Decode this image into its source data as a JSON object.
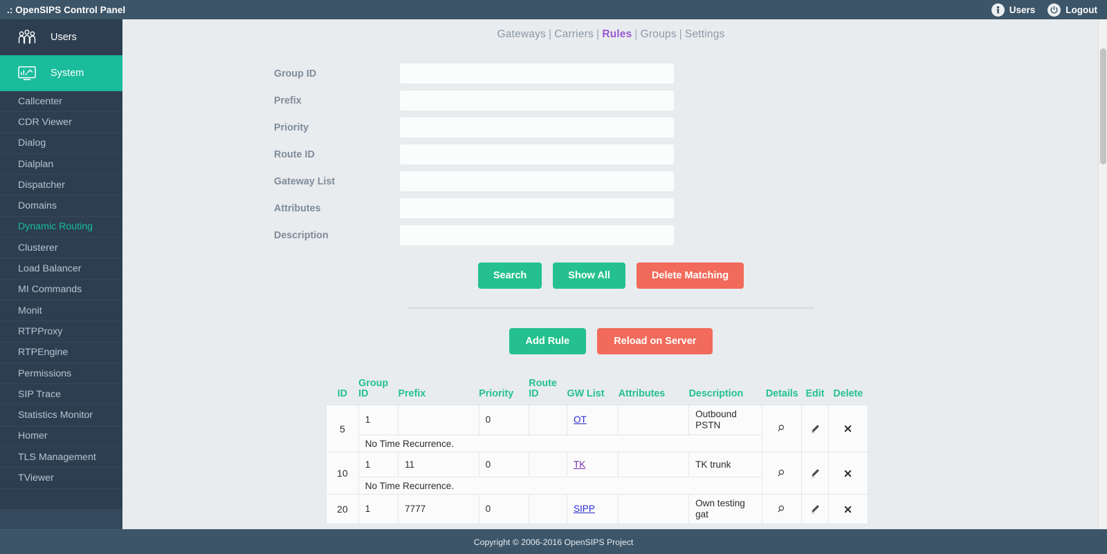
{
  "header": {
    "title": ".: OpenSIPS Control Panel",
    "users_label": "Users",
    "logout_label": "Logout"
  },
  "sidebar": {
    "main": [
      {
        "label": "Users",
        "icon": "users-group-icon",
        "active": false
      },
      {
        "label": "System",
        "icon": "system-monitor-icon",
        "active": true
      }
    ],
    "items": [
      {
        "label": "Callcenter",
        "active": false
      },
      {
        "label": "CDR Viewer",
        "active": false
      },
      {
        "label": "Dialog",
        "active": false
      },
      {
        "label": "Dialplan",
        "active": false
      },
      {
        "label": "Dispatcher",
        "active": false
      },
      {
        "label": "Domains",
        "active": false
      },
      {
        "label": "Dynamic Routing",
        "active": true
      },
      {
        "label": "Clusterer",
        "active": false
      },
      {
        "label": "Load Balancer",
        "active": false
      },
      {
        "label": "MI Commands",
        "active": false
      },
      {
        "label": "Monit",
        "active": false
      },
      {
        "label": "RTPProxy",
        "active": false
      },
      {
        "label": "RTPEngine",
        "active": false
      },
      {
        "label": "Permissions",
        "active": false
      },
      {
        "label": "SIP Trace",
        "active": false
      },
      {
        "label": "Statistics Monitor",
        "active": false
      },
      {
        "label": "Homer",
        "active": false
      },
      {
        "label": "TLS Management",
        "active": false
      },
      {
        "label": "TViewer",
        "active": false
      }
    ]
  },
  "tabs": [
    {
      "label": "Gateways",
      "active": false
    },
    {
      "label": "Carriers",
      "active": false
    },
    {
      "label": "Rules",
      "active": true
    },
    {
      "label": "Groups",
      "active": false
    },
    {
      "label": "Settings",
      "active": false
    }
  ],
  "tab_separator": "|",
  "form": {
    "fields": [
      {
        "label": "Group ID",
        "value": "",
        "placeholder": ""
      },
      {
        "label": "Prefix",
        "value": "",
        "placeholder": ""
      },
      {
        "label": "Priority",
        "value": "",
        "placeholder": ""
      },
      {
        "label": "Route ID",
        "value": "",
        "placeholder": ""
      },
      {
        "label": "Gateway List",
        "value": "",
        "placeholder": ""
      },
      {
        "label": "Attributes",
        "value": "",
        "placeholder": ""
      },
      {
        "label": "Description",
        "value": "",
        "placeholder": ""
      }
    ]
  },
  "actions": {
    "search": "Search",
    "show_all": "Show All",
    "delete_matching": "Delete Matching",
    "add_rule": "Add Rule",
    "reload_on_server": "Reload on Server"
  },
  "table": {
    "headers": [
      "ID",
      "Group ID",
      "Prefix",
      "Priority",
      "Route ID",
      "GW List",
      "Attributes",
      "Description",
      "Details",
      "Edit",
      "Delete"
    ],
    "rows": [
      {
        "id": "5",
        "group_id": "1",
        "prefix": "",
        "priority": "0",
        "route_id": "",
        "gw_list": "OT",
        "gw_visited": false,
        "attributes": "",
        "description": "Outbound PSTN",
        "time_recurrence": "No Time Recurrence."
      },
      {
        "id": "10",
        "group_id": "1",
        "prefix": "11",
        "priority": "0",
        "route_id": "",
        "gw_list": "TK",
        "gw_visited": true,
        "attributes": "",
        "description": "TK trunk",
        "time_recurrence": "No Time Recurrence."
      },
      {
        "id": "20",
        "group_id": "1",
        "prefix": "7777",
        "priority": "0",
        "route_id": "",
        "gw_list": "SIPP",
        "gw_visited": false,
        "attributes": "",
        "description": "Own testing gat",
        "time_recurrence": ""
      }
    ],
    "icons": {
      "details": "magnifier-icon",
      "edit": "pencil-icon",
      "delete": "cross-icon"
    }
  },
  "footer": {
    "copyright": "Copyright © 2006-2016 OpenSIPS Project"
  },
  "colors": {
    "accent_green": "#24c18e",
    "accent_red": "#f26a5b",
    "sidebar_bg": "#2c3e50",
    "topbar_bg": "#3d5568",
    "tab_active": "#9b59d0"
  }
}
